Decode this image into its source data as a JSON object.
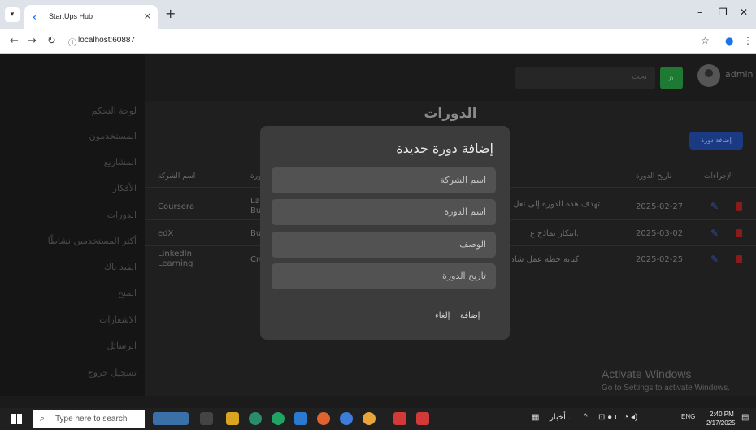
{
  "browser": {
    "tab_title": "StartUps Hub",
    "tab_close": "×",
    "new_tab": "+",
    "url": "localhost:60887",
    "controls": {
      "minimize": "–",
      "restore": "❐",
      "close": "✕"
    }
  },
  "sidebar": {
    "items": [
      {
        "label": "لوحة التحكم"
      },
      {
        "label": "المستخدمون"
      },
      {
        "label": "المشاريع"
      },
      {
        "label": "الأفكار"
      },
      {
        "label": "الدورات"
      },
      {
        "label": "أكثر المستخدمين نشاطًا"
      },
      {
        "label": "الفيد باك"
      },
      {
        "label": "المنح"
      },
      {
        "label": "الاشعارات"
      },
      {
        "label": "الرسائل"
      },
      {
        "label": "تسجيل خروج"
      }
    ]
  },
  "topbar": {
    "search_placeholder": "بحث",
    "user_name": "admin"
  },
  "main": {
    "title": "الدورات",
    "add_button": "إضافة دورة",
    "columns": {
      "company": "اسم الشركة",
      "course": "ورة",
      "date": "تاريخ الدورة",
      "actions": "الإجراءات"
    },
    "rows": [
      {
        "company": "Coursera",
        "course": "La Bu",
        "description": "تهدف هذه الدورة إلى تعل",
        "date": "2025-02-27"
      },
      {
        "company": "edX",
        "course": "Bu",
        "description": ".ابتكار نماذج ع",
        "date": "2025-03-02"
      },
      {
        "company": "LinkedIn Learning",
        "course": "Cre",
        "description": "كتابة خطة عمل شاه",
        "date": "2025-02-25"
      }
    ]
  },
  "modal": {
    "title": "إضافة دورة جديدة",
    "fields": {
      "company": "اسم الشركة",
      "course_name": "اسم الدورة",
      "description": "الوصف",
      "course_date": "تاريخ الدورة"
    },
    "submit": "إضافة",
    "cancel": "إلغاء"
  },
  "watermark": {
    "line1": "Activate Windows",
    "line2": "Go to Settings to activate Windows."
  },
  "taskbar": {
    "search_placeholder": "Type here to search",
    "news": "أخبار...",
    "lang": "ENG",
    "time": "2:40 PM",
    "date": "2/17/2025"
  },
  "colors": {
    "accent_green": "#1e7a33",
    "accent_blue": "#1b3a84",
    "delete_red": "#8a1b1b"
  }
}
